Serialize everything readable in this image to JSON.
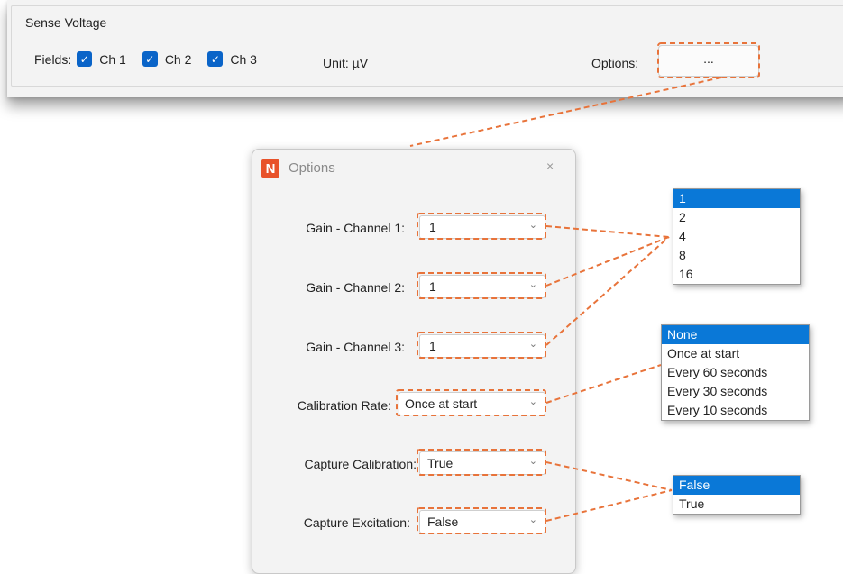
{
  "group": {
    "title": "Sense Voltage",
    "fields_label": "Fields:",
    "channels": [
      "Ch 1",
      "Ch 2",
      "Ch 3"
    ],
    "unit_label": "Unit:  µV",
    "options_label": "Options:",
    "options_button": "..."
  },
  "dialog": {
    "title": "Options",
    "logo_letter": "N",
    "close": "×",
    "rows": [
      {
        "label": "Gain - Channel 1:",
        "value": "1"
      },
      {
        "label": "Gain - Channel 2:",
        "value": "1"
      },
      {
        "label": "Gain - Channel 3:",
        "value": "1"
      },
      {
        "label": "Calibration Rate:",
        "value": "Once at start"
      },
      {
        "label": "Capture Calibration:",
        "value": "True"
      },
      {
        "label": "Capture Excitation:",
        "value": "False"
      }
    ]
  },
  "dropdowns": {
    "gain": {
      "items": [
        "1",
        "2",
        "4",
        "8",
        "16"
      ],
      "selected": "1"
    },
    "calibration_rate": {
      "items": [
        "None",
        "Once at start",
        "Every 60 seconds",
        "Every 30 seconds",
        "Every 10 seconds"
      ],
      "selected": "None"
    },
    "boolean": {
      "items": [
        "False",
        "True"
      ],
      "selected": "False"
    }
  },
  "colors": {
    "accent": "#0a64c8",
    "selection": "#0a78d7",
    "annotation": "#e8733a",
    "logo": "#e8522a"
  }
}
